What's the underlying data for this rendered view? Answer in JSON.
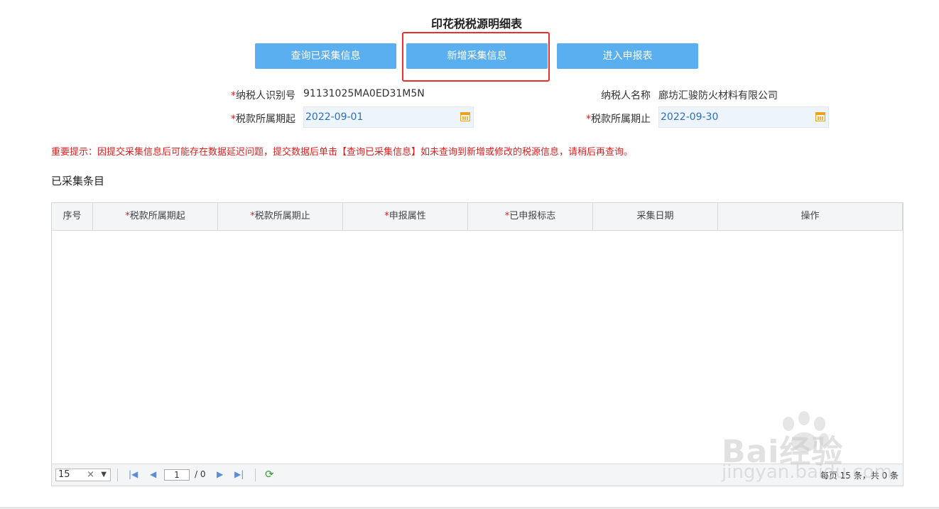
{
  "page": {
    "title": "印花税税源明细表"
  },
  "buttons": {
    "query": "查询已采集信息",
    "add": "新增采集信息",
    "enter": "进入申报表"
  },
  "form": {
    "taxpayer_id_label": "纳税人识别号",
    "taxpayer_id_value": "91131025MA0ED31M5N",
    "taxpayer_name_label": "纳税人名称",
    "taxpayer_name_value": "廊坊汇骏防火材料有限公司",
    "period_start_label": "税款所属期起",
    "period_start_value": "2022-09-01",
    "period_end_label": "税款所属期止",
    "period_end_value": "2022-09-30",
    "required_mark": "*"
  },
  "notice": "重要提示：因提交采集信息后可能存在数据延迟问题，提交数据后单击【查询已采集信息】如未查询到新增或修改的税源信息，请稍后再查询。",
  "section_title": "已采集条目",
  "table": {
    "columns": [
      {
        "label": "序号",
        "required": false
      },
      {
        "label": "税款所属期起",
        "required": true
      },
      {
        "label": "税款所属期止",
        "required": true
      },
      {
        "label": "申报属性",
        "required": true
      },
      {
        "label": "已申报标志",
        "required": true
      },
      {
        "label": "采集日期",
        "required": false
      },
      {
        "label": "操作",
        "required": false
      }
    ],
    "rows": []
  },
  "pager": {
    "page_size": "15",
    "clear": "×",
    "current_page": "1",
    "total_pages": "/ 0",
    "info": "每页 15 条，共 0 条"
  },
  "watermark": {
    "line1": "Bai经验",
    "line2": "jingyan.baidu.com"
  },
  "colors": {
    "button": "#5aaff0",
    "highlight": "#e8312f",
    "required": "#e02020",
    "notice": "#e02020"
  }
}
